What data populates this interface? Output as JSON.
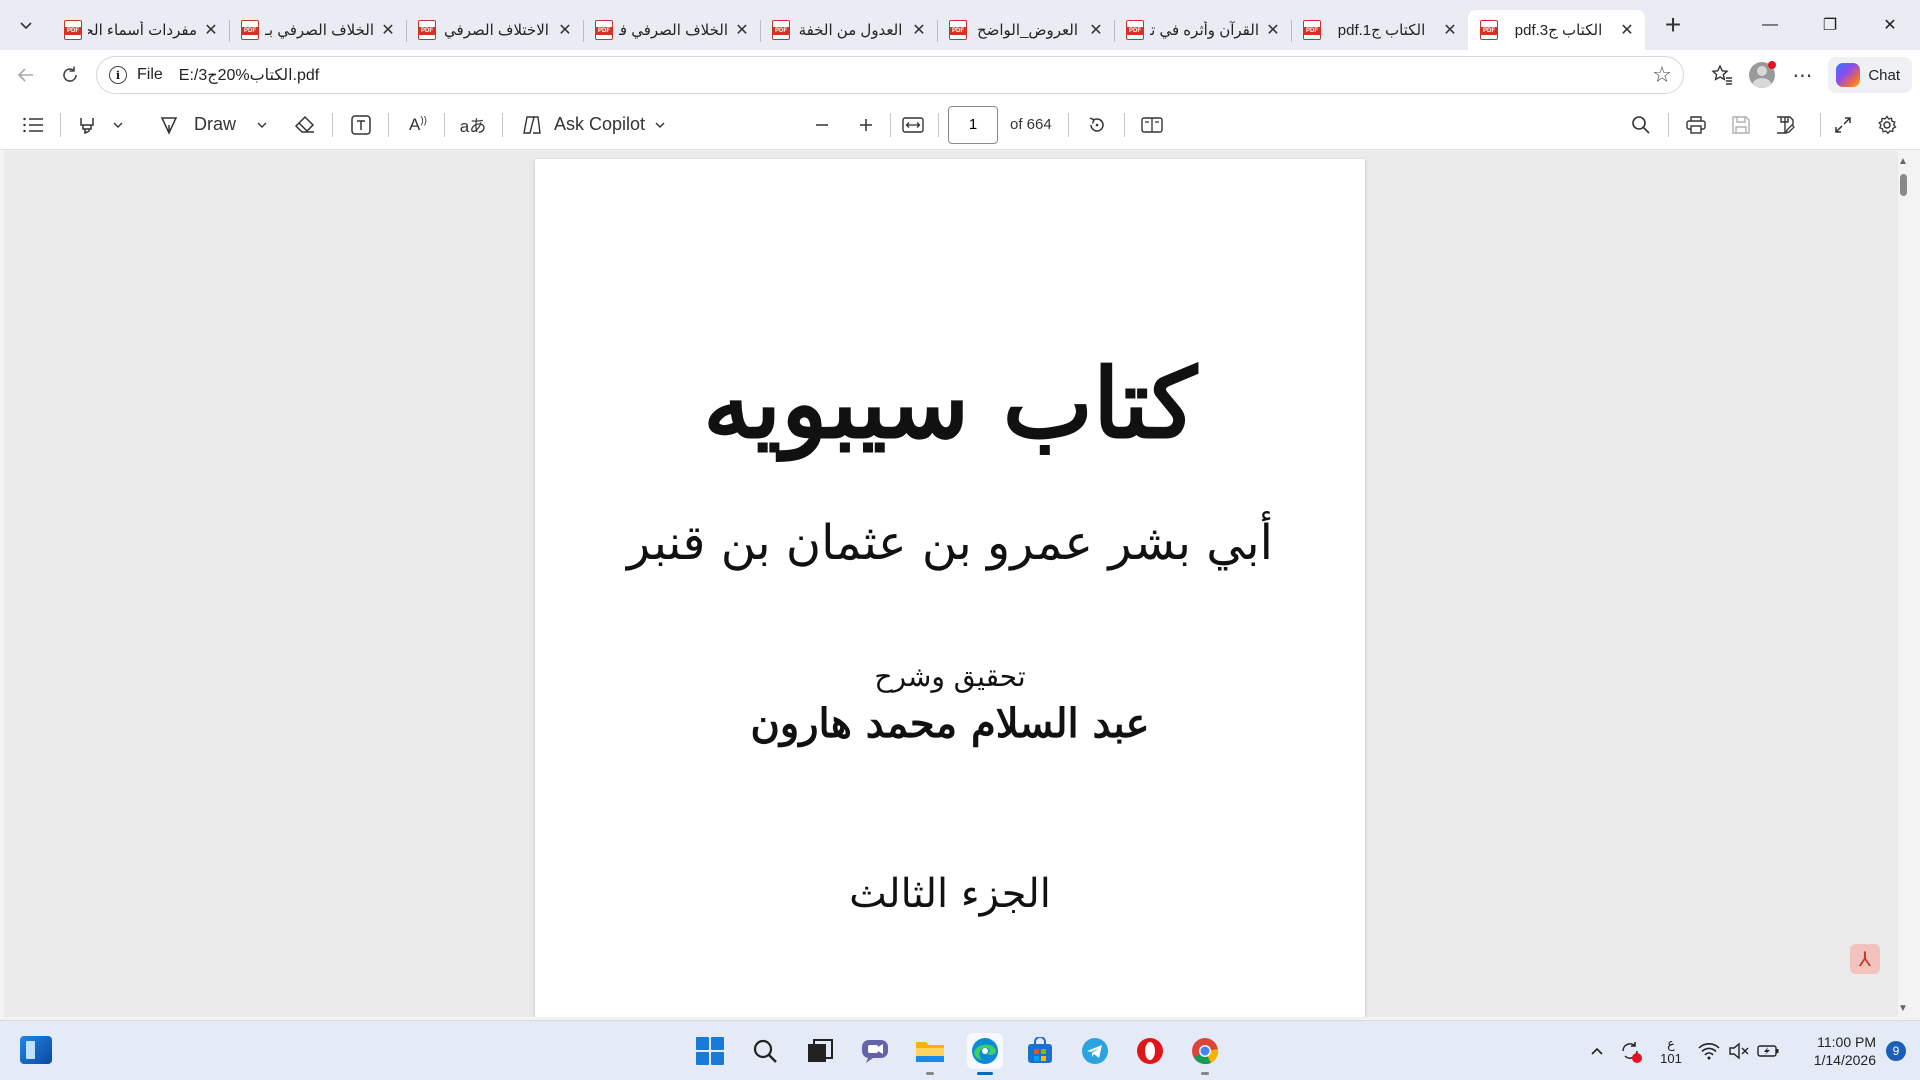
{
  "browser": {
    "tabs": [
      {
        "title": "مفردات أسماء الحـ",
        "active": false
      },
      {
        "title": "الخلاف الصرفي بـ",
        "active": false
      },
      {
        "title": "الاختلاف الصرفي",
        "active": false
      },
      {
        "title": "الخلاف الصرفي فـ",
        "active": false
      },
      {
        "title": "العدول من الخفة",
        "active": false
      },
      {
        "title": "العروض_الواضح",
        "active": false
      },
      {
        "title": "القرآن وأثره في تـ",
        "active": false
      },
      {
        "title": "الكتاب ج1.pdf",
        "active": false
      },
      {
        "title": "الكتاب ج3.pdf",
        "active": true
      }
    ],
    "new_tab": "+",
    "window_controls": {
      "minimize": "—",
      "restore": "❐",
      "close": "✕"
    }
  },
  "address_bar": {
    "scheme_label": "File",
    "url": "E:/الكتاب%20ج3.pdf",
    "chat_label": "Chat"
  },
  "pdf_toolbar": {
    "draw_label": "Draw",
    "ask_copilot_label": "Ask Copilot",
    "page_current": "1",
    "page_total_label": "of 664"
  },
  "document": {
    "title": "كتاب سيبويه",
    "author": "أبي بشر عمرو بن عثمان بن قنبر",
    "editing_label": "تحقيق وشرح",
    "editor": "عبد السلام محمد هارون",
    "volume": "الجزء الثالث"
  },
  "taskbar": {
    "ime_line1": "ع",
    "ime_line2": "101",
    "time": "11:00 PM",
    "date": "1/14/2026",
    "notification_count": "9"
  },
  "colors": {
    "accent": "#0067c0",
    "pdf_red": "#d93025",
    "tabstrip": "#e9ecf2"
  }
}
